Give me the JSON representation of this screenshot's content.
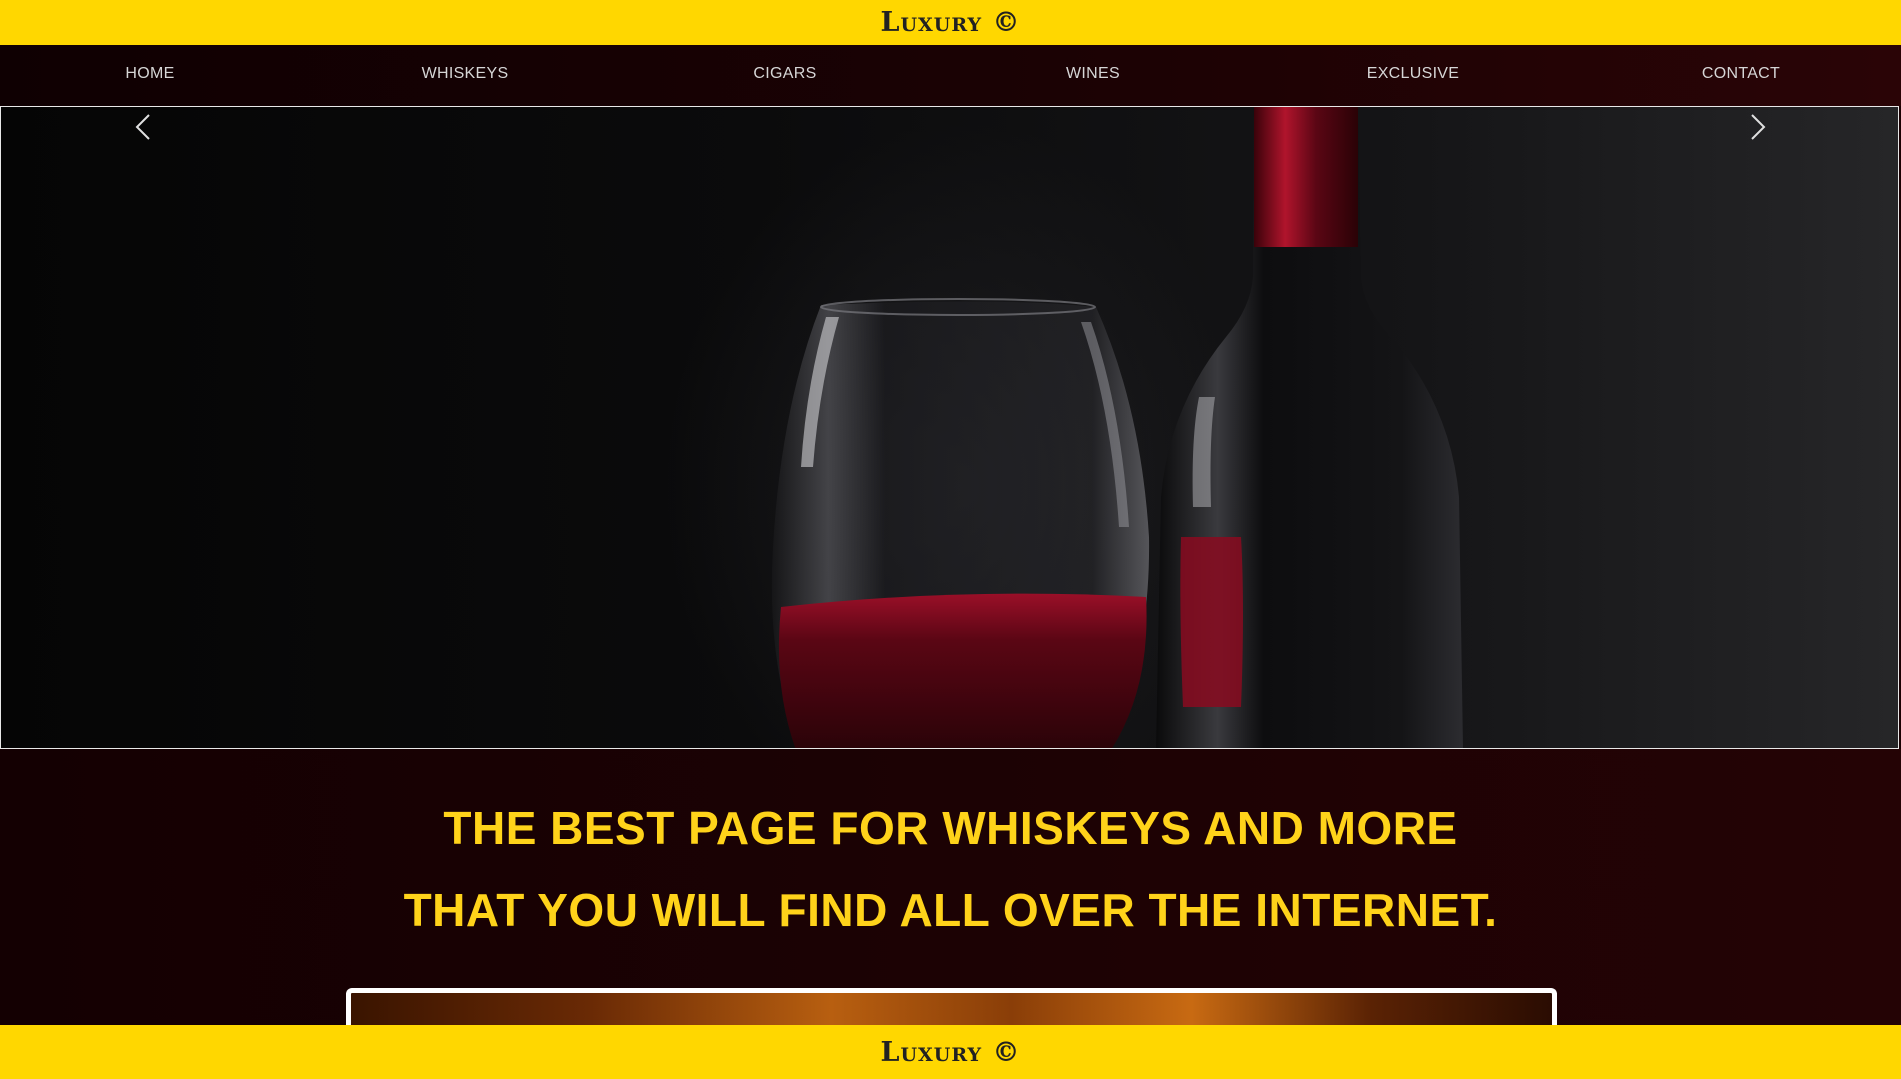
{
  "header": {
    "brand": "Luxury ©"
  },
  "nav": {
    "items": [
      "Home",
      "Whiskeys",
      "Cigars",
      "Wines",
      "Exclusive",
      "Contact"
    ]
  },
  "hero": {
    "image_description": "wine-glass-and-bottle",
    "prev_icon": "chevron-left-icon",
    "next_icon": "chevron-right-icon"
  },
  "main": {
    "headline_line1": "The best page for whiskeys and more",
    "headline_line2": "that you will find all over the internet."
  },
  "footer": {
    "brand": "Luxury ©"
  },
  "colors": {
    "accent": "#ffd700",
    "headline": "#ffd31a",
    "background": "#1a0103",
    "nav_text": "#d6d6d6"
  }
}
